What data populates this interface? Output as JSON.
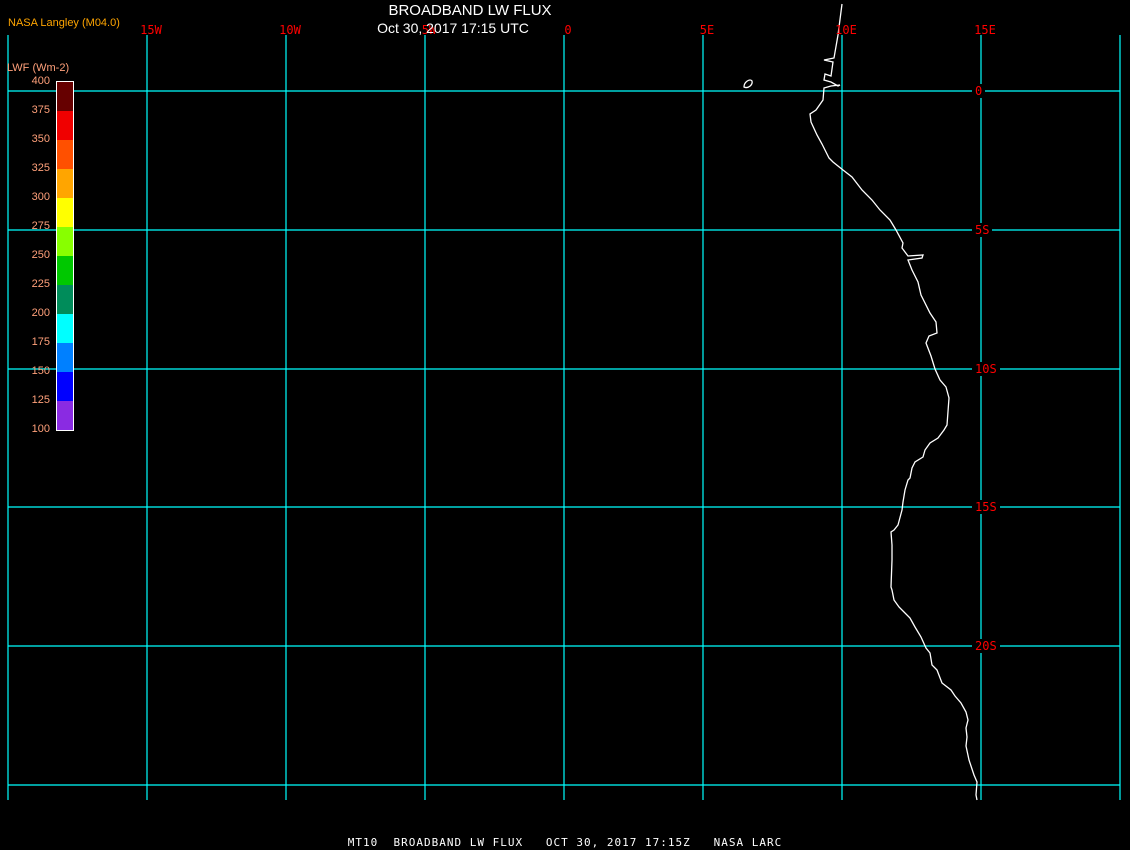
{
  "header": {
    "title": "BROADBAND LW FLUX",
    "subtitle": "Oct 30, 2017 17:15 UTC",
    "source": "NASA Langley (M04.0)"
  },
  "legend": {
    "title": "LWF (Wm-2)",
    "ticks": [
      "400",
      "375",
      "350",
      "325",
      "300",
      "275",
      "250",
      "225",
      "200",
      "175",
      "150",
      "125",
      "100"
    ],
    "colors": [
      "#660000",
      "#f00000",
      "#ff5000",
      "#ffa500",
      "#ffff00",
      "#88ff00",
      "#00c800",
      "#008c5a",
      "#00ffff",
      "#0080ff",
      "#0000ff",
      "#8a2be2"
    ]
  },
  "map": {
    "longitude_labels": [
      "15W",
      "10W",
      "5W",
      "0",
      "5E",
      "10E",
      "15E"
    ],
    "latitude_labels": [
      "0",
      "5S",
      "10S",
      "15S",
      "20S"
    ],
    "grid_color": "#00ffff",
    "label_color": "#ff0000",
    "coastline_color": "#ffffff"
  },
  "footer": {
    "text": "MT10  BROADBAND LW FLUX   OCT 30, 2017 17:15Z   NASA LARC"
  }
}
